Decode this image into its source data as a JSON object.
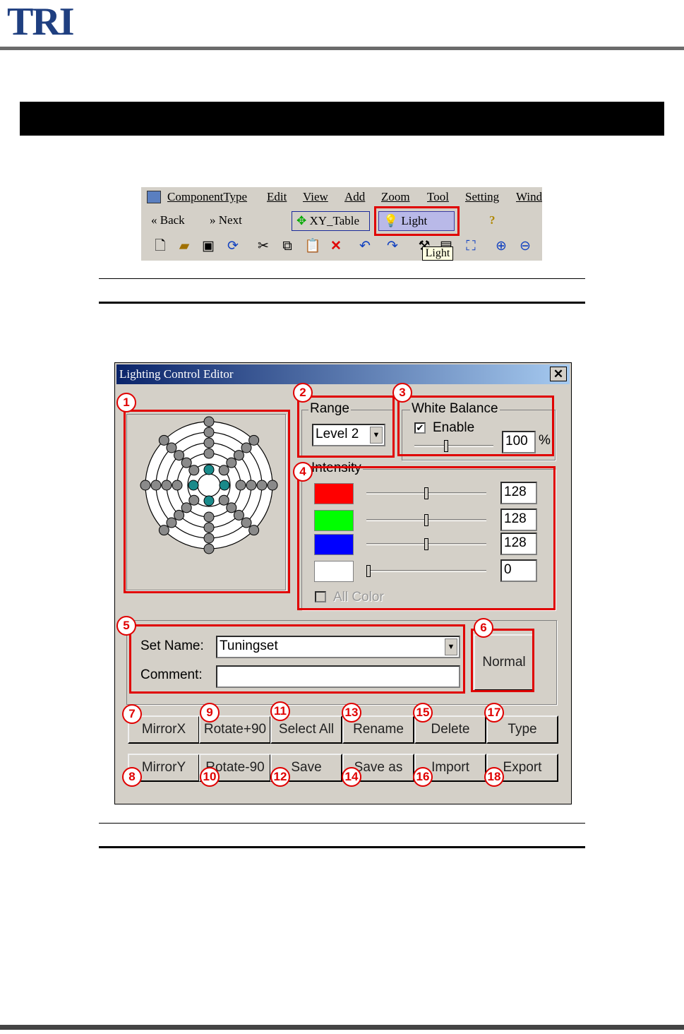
{
  "header": {
    "logo": "TRI"
  },
  "toolbar": {
    "menu": [
      "ComponentType",
      "Edit",
      "View",
      "Add",
      "Zoom",
      "Tool",
      "Setting",
      "Wind"
    ],
    "back": "Back",
    "next": "Next",
    "xy_table": "XY_Table",
    "light": "Light",
    "tooltip": "Light"
  },
  "dialog": {
    "title": "Lighting Control Editor",
    "close": "✕",
    "range": {
      "label": "Range",
      "value": "Level 2"
    },
    "white_balance": {
      "label": "White Balance",
      "enable_label": "Enable",
      "enabled": true,
      "value": "100",
      "unit": "%",
      "level": 0.4
    },
    "intensity": {
      "label": "Intensity",
      "channels": [
        {
          "color": "#ff0000",
          "value": "128",
          "level": 0.5
        },
        {
          "color": "#00ff00",
          "value": "128",
          "level": 0.5
        },
        {
          "color": "#0000ff",
          "value": "128",
          "level": 0.5
        },
        {
          "color": "#ffffff",
          "value": "0",
          "level": 0.0
        }
      ],
      "all_color": "All Color"
    },
    "set_name_label": "Set Name:",
    "set_name_value": "Tuningset",
    "comment_label": "Comment:",
    "comment_value": "",
    "normal": "Normal",
    "buttons_row1": [
      "MirrorX",
      "Rotate+90",
      "Select All",
      "Rename",
      "Delete",
      "Type"
    ],
    "buttons_row2": [
      "MirrorY",
      "Rotate-90",
      "Save",
      "Save as",
      "Import",
      "Export"
    ],
    "markers": [
      "1",
      "2",
      "3",
      "4",
      "5",
      "6",
      "7",
      "8",
      "9",
      "10",
      "11",
      "12",
      "13",
      "14",
      "15",
      "16",
      "17",
      "18"
    ]
  }
}
